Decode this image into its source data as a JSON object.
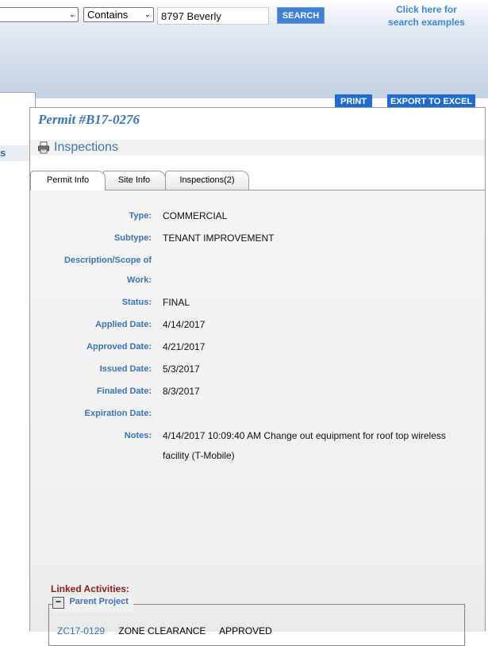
{
  "search": {
    "field_select": "",
    "operator_select": "Contains",
    "query_value": "8797 Beverly",
    "button_label": "SEARCH",
    "help_link": "Click here for search examples"
  },
  "sidebar": {
    "partial_label": "s"
  },
  "toolbar": {
    "print_label": "PRINT",
    "export_label": "EXPORT TO EXCEL"
  },
  "permit": {
    "title": "Permit #B17-0276",
    "inspections_label": "Inspections"
  },
  "tabs": [
    {
      "label": "Permit Info",
      "active": true
    },
    {
      "label": "Site Info",
      "active": false
    },
    {
      "label": "Inspections(2)",
      "active": false
    }
  ],
  "fields": {
    "type_label": "Type:",
    "type_value": "COMMERCIAL",
    "subtype_label": "Subtype:",
    "subtype_value": "TENANT IMPROVEMENT",
    "desc_label_1": "Description/Scope of",
    "desc_label_2": "Work:",
    "desc_value": "",
    "status_label": "Status:",
    "status_value": "FINAL",
    "applied_label": "Applied Date:",
    "applied_value": "4/14/2017",
    "approved_label": "Approved Date:",
    "approved_value": "4/21/2017",
    "issued_label": "Issued Date:",
    "issued_value": "5/3/2017",
    "finaled_label": "Finaled Date:",
    "finaled_value": "8/3/2017",
    "expiration_label": "Expiration Date:",
    "expiration_value": "",
    "notes_label": "Notes:",
    "notes_value": "4/14/2017 10:09:40 AM Change out equipment for roof top wireless facility (T-Mobile)"
  },
  "linked": {
    "heading": "Linked Activities:",
    "group_title": "Parent Project",
    "toggle_symbol": "−",
    "activity_id": "ZC17-0129",
    "activity_type": "ZONE CLEARANCE",
    "activity_status": "APPROVED"
  },
  "colors": {
    "accent": "#3b73b5",
    "button": "#1f6bd4",
    "linked_heading": "#8b1c1c"
  }
}
